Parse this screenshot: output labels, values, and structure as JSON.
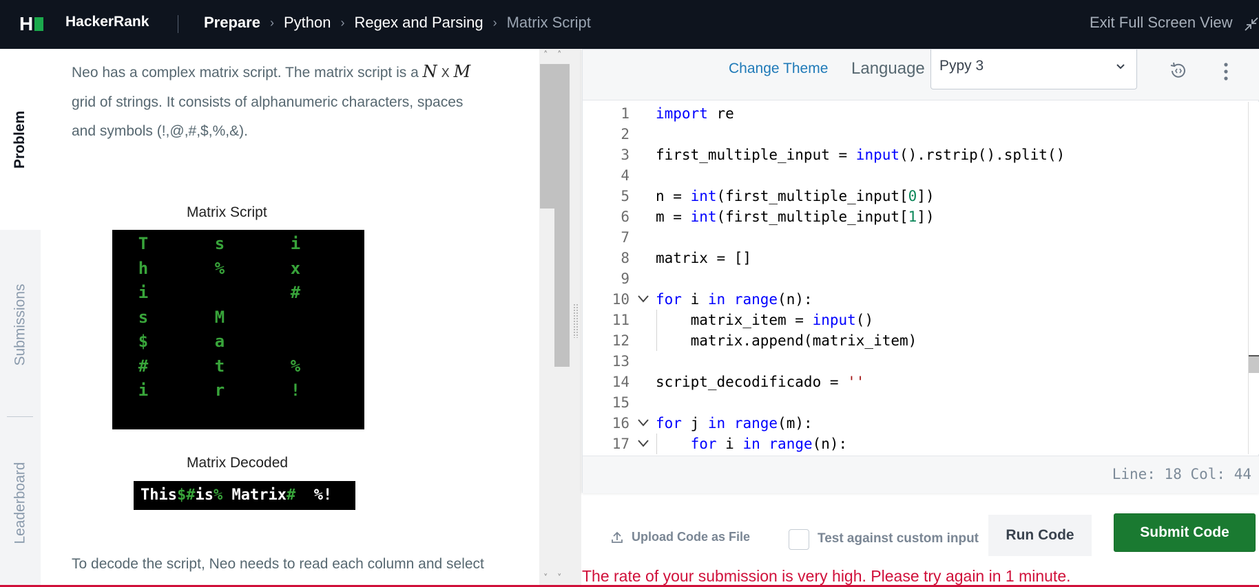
{
  "header": {
    "brand": "HackerRank",
    "breadcrumbs": [
      "Prepare",
      "Python",
      "Regex and Parsing",
      "Matrix Script"
    ],
    "exit_fullscreen": "Exit Full Screen View",
    "colors": {
      "background": "#0e141e",
      "logo_green": "#1ba94c"
    }
  },
  "sidetabs": {
    "problem": "Problem",
    "submissions": "Submissions",
    "leaderboard": "Leaderboard"
  },
  "problem": {
    "intro_1": "Neo has a complex matrix script. The matrix script is a",
    "math_n": "N",
    "math_x": "X",
    "math_m": "M",
    "intro_2": "grid of strings. It consists of alphanumeric characters, spaces",
    "intro_3": "and symbols (!,@,#,$,%,&).",
    "figure1_title": "Matrix Script",
    "matrix_rows": [
      [
        "T",
        "s",
        "i"
      ],
      [
        "h",
        "%",
        "x"
      ],
      [
        "i",
        "",
        "#"
      ],
      [
        "s",
        "M",
        ""
      ],
      [
        "$",
        "a",
        ""
      ],
      [
        "#",
        "t",
        "%"
      ],
      [
        "i",
        "r",
        "!"
      ]
    ],
    "figure2_title": "Matrix Decoded",
    "decoded_parts": [
      {
        "text": "This",
        "green": false
      },
      {
        "text": "$#",
        "green": true
      },
      {
        "text": "is",
        "green": false
      },
      {
        "text": "%",
        "green": true
      },
      {
        "text": " Matrix",
        "green": false
      },
      {
        "text": "#",
        "green": true
      },
      {
        "text": "  %!",
        "green": false
      }
    ],
    "outro": "To decode the script, Neo needs to read each column and select"
  },
  "editor": {
    "change_theme": "Change Theme",
    "language_label": "Language",
    "language_value": "Pypy 3",
    "status": "Line: 18 Col: 44",
    "lines": [
      {
        "n": "1",
        "fold": false,
        "indent": 0,
        "tokens": [
          [
            "kw",
            "import"
          ],
          [
            "t",
            " re"
          ]
        ]
      },
      {
        "n": "2",
        "fold": false,
        "indent": 0,
        "tokens": []
      },
      {
        "n": "3",
        "fold": false,
        "indent": 0,
        "tokens": [
          [
            "t",
            "first_multiple_input = "
          ],
          [
            "bi",
            "input"
          ],
          [
            "t",
            "().rstrip().split()"
          ]
        ]
      },
      {
        "n": "4",
        "fold": false,
        "indent": 0,
        "tokens": []
      },
      {
        "n": "5",
        "fold": false,
        "indent": 0,
        "tokens": [
          [
            "t",
            "n = "
          ],
          [
            "bi",
            "int"
          ],
          [
            "t",
            "(first_multiple_input["
          ],
          [
            "num",
            "0"
          ],
          [
            "t",
            "])"
          ]
        ]
      },
      {
        "n": "6",
        "fold": false,
        "indent": 0,
        "tokens": [
          [
            "t",
            "m = "
          ],
          [
            "bi",
            "int"
          ],
          [
            "t",
            "(first_multiple_input["
          ],
          [
            "num",
            "1"
          ],
          [
            "t",
            "])"
          ]
        ]
      },
      {
        "n": "7",
        "fold": false,
        "indent": 0,
        "tokens": []
      },
      {
        "n": "8",
        "fold": false,
        "indent": 0,
        "tokens": [
          [
            "t",
            "matrix = []"
          ]
        ]
      },
      {
        "n": "9",
        "fold": false,
        "indent": 0,
        "tokens": []
      },
      {
        "n": "10",
        "fold": true,
        "indent": 0,
        "tokens": [
          [
            "kw",
            "for"
          ],
          [
            "t",
            " i "
          ],
          [
            "kw",
            "in"
          ],
          [
            "t",
            " "
          ],
          [
            "bi",
            "range"
          ],
          [
            "t",
            "(n):"
          ]
        ]
      },
      {
        "n": "11",
        "fold": false,
        "indent": 1,
        "tokens": [
          [
            "t",
            "    matrix_item = "
          ],
          [
            "bi",
            "input"
          ],
          [
            "t",
            "()"
          ]
        ]
      },
      {
        "n": "12",
        "fold": false,
        "indent": 1,
        "tokens": [
          [
            "t",
            "    matrix.append(matrix_item)"
          ]
        ]
      },
      {
        "n": "13",
        "fold": false,
        "indent": 0,
        "tokens": []
      },
      {
        "n": "14",
        "fold": false,
        "indent": 0,
        "tokens": [
          [
            "t",
            "script_decodificado = "
          ],
          [
            "str",
            "''"
          ]
        ]
      },
      {
        "n": "15",
        "fold": false,
        "indent": 0,
        "tokens": []
      },
      {
        "n": "16",
        "fold": true,
        "indent": 0,
        "tokens": [
          [
            "kw",
            "for"
          ],
          [
            "t",
            " j "
          ],
          [
            "kw",
            "in"
          ],
          [
            "t",
            " "
          ],
          [
            "bi",
            "range"
          ],
          [
            "t",
            "(m):"
          ]
        ]
      },
      {
        "n": "17",
        "fold": true,
        "indent": 1,
        "tokens": [
          [
            "t",
            "    "
          ],
          [
            "kw",
            "for"
          ],
          [
            "t",
            " i "
          ],
          [
            "kw",
            "in"
          ],
          [
            "t",
            " "
          ],
          [
            "bi",
            "range"
          ],
          [
            "t",
            "(n):"
          ]
        ]
      }
    ]
  },
  "actions": {
    "upload": "Upload Code as File",
    "custom_input": "Test against custom input",
    "run": "Run Code",
    "submit": "Submit Code",
    "error": "The rate of your submission is very high. Please try again in 1 minute."
  },
  "icons": [
    "hackerrank-logo",
    "collapse-icon",
    "chevron-down-icon",
    "reset-code-icon",
    "more-options-icon",
    "upload-icon",
    "fold-arrow-icon"
  ]
}
